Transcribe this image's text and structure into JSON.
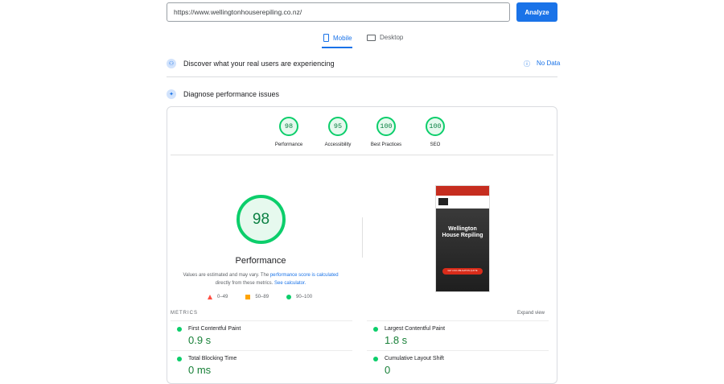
{
  "search": {
    "url": "https://www.wellingtonhouserepiling.co.nz/",
    "analyze": "Analyze"
  },
  "tabs": [
    {
      "label": "Mobile",
      "icon": "mobile-icon"
    },
    {
      "label": "Desktop",
      "icon": "desktop-icon"
    }
  ],
  "field": {
    "title": "Discover what your real users are experiencing",
    "status": "No Data"
  },
  "lab": {
    "title": "Diagnose performance issues"
  },
  "scores": [
    {
      "label": "Performance",
      "value": "98"
    },
    {
      "label": "Accessibility",
      "value": "95"
    },
    {
      "label": "Best Practices",
      "value": "100"
    },
    {
      "label": "SEO",
      "value": "100"
    }
  ],
  "main": {
    "score": "98",
    "label": "Performance",
    "note1": "Values are estimated and may vary. The ",
    "link1": "performance score is calculated",
    "note2": " directly from these metrics. ",
    "link2": "See calculator.",
    "legend": [
      "0–49",
      "50–89",
      "90–100"
    ]
  },
  "preview": {
    "title": "Wellington House Repiling",
    "cta": "GET A NO-OBLIGATION QUOTE"
  },
  "metrics": {
    "heading": "METRICS",
    "expand": "Expand view",
    "items": [
      {
        "name": "First Contentful Paint",
        "value": "0.9 s"
      },
      {
        "name": "Largest Contentful Paint",
        "value": "1.8 s"
      },
      {
        "name": "Total Blocking Time",
        "value": "0 ms"
      },
      {
        "name": "Cumulative Layout Shift",
        "value": "0"
      }
    ]
  },
  "colors": {
    "accent": "#1a73e8",
    "good": "#0cce6b",
    "average": "#ffa400",
    "poor": "#ff4e42"
  }
}
